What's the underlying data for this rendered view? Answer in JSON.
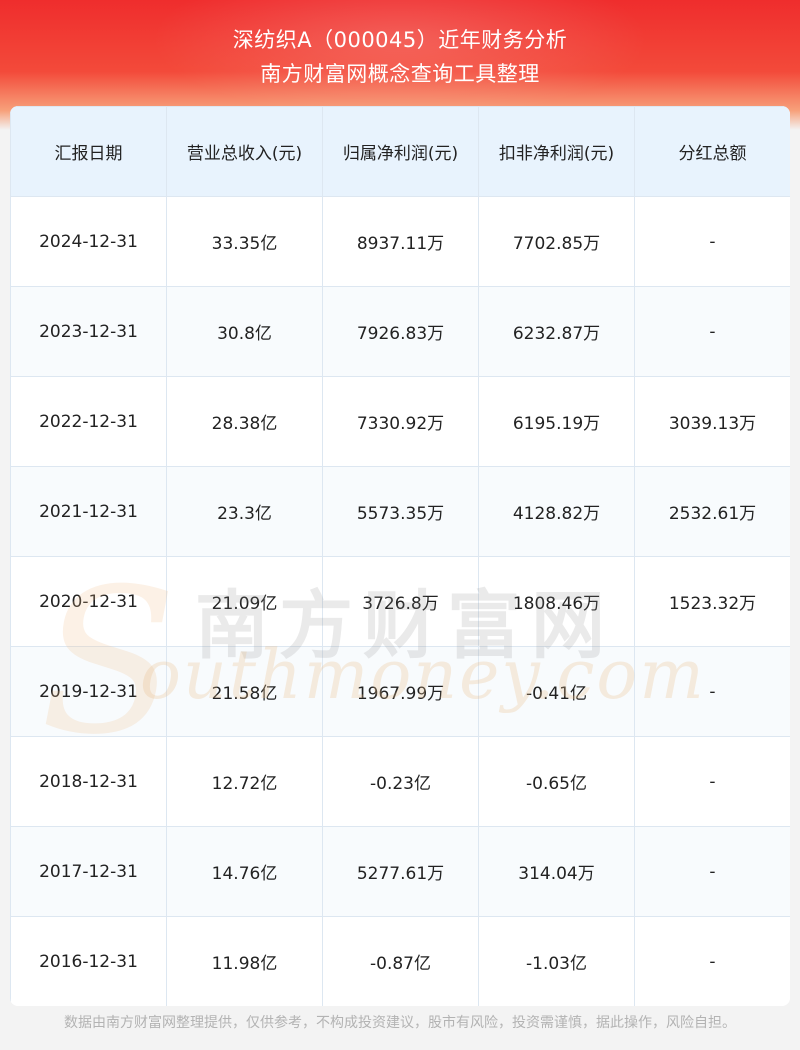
{
  "header": {
    "title_line1": "深纺织A（000045）近年财务分析",
    "title_line2": "南方财富网概念查询工具整理"
  },
  "table": {
    "columns": [
      "汇报日期",
      "营业总收入(元)",
      "归属净利润(元)",
      "扣非净利润(元)",
      "分红总额"
    ],
    "rows": [
      [
        "2024-12-31",
        "33.35亿",
        "8937.11万",
        "7702.85万",
        "-"
      ],
      [
        "2023-12-31",
        "30.8亿",
        "7926.83万",
        "6232.87万",
        "-"
      ],
      [
        "2022-12-31",
        "28.38亿",
        "7330.92万",
        "6195.19万",
        "3039.13万"
      ],
      [
        "2021-12-31",
        "23.3亿",
        "5573.35万",
        "4128.82万",
        "2532.61万"
      ],
      [
        "2020-12-31",
        "21.09亿",
        "3726.8万",
        "1808.46万",
        "1523.32万"
      ],
      [
        "2019-12-31",
        "21.58亿",
        "1967.99万",
        "-0.41亿",
        "-"
      ],
      [
        "2018-12-31",
        "12.72亿",
        "-0.23亿",
        "-0.65亿",
        "-"
      ],
      [
        "2017-12-31",
        "14.76亿",
        "5277.61万",
        "314.04万",
        "-"
      ],
      [
        "2016-12-31",
        "11.98亿",
        "-0.87亿",
        "-1.03亿",
        "-"
      ]
    ]
  },
  "watermark": {
    "cn": "南方财富网",
    "en": "outhmoney.com",
    "initial": "S"
  },
  "footer": {
    "disclaimer": "数据由南方财富网整理提供，仅供参考，不构成投资建议，股市有风险，投资需谨慎，据此操作，风险自担。"
  },
  "colors": {
    "header_red": "#ef2d2d",
    "header_head_bg": "#e8f3fd",
    "border": "#dde7f1"
  }
}
